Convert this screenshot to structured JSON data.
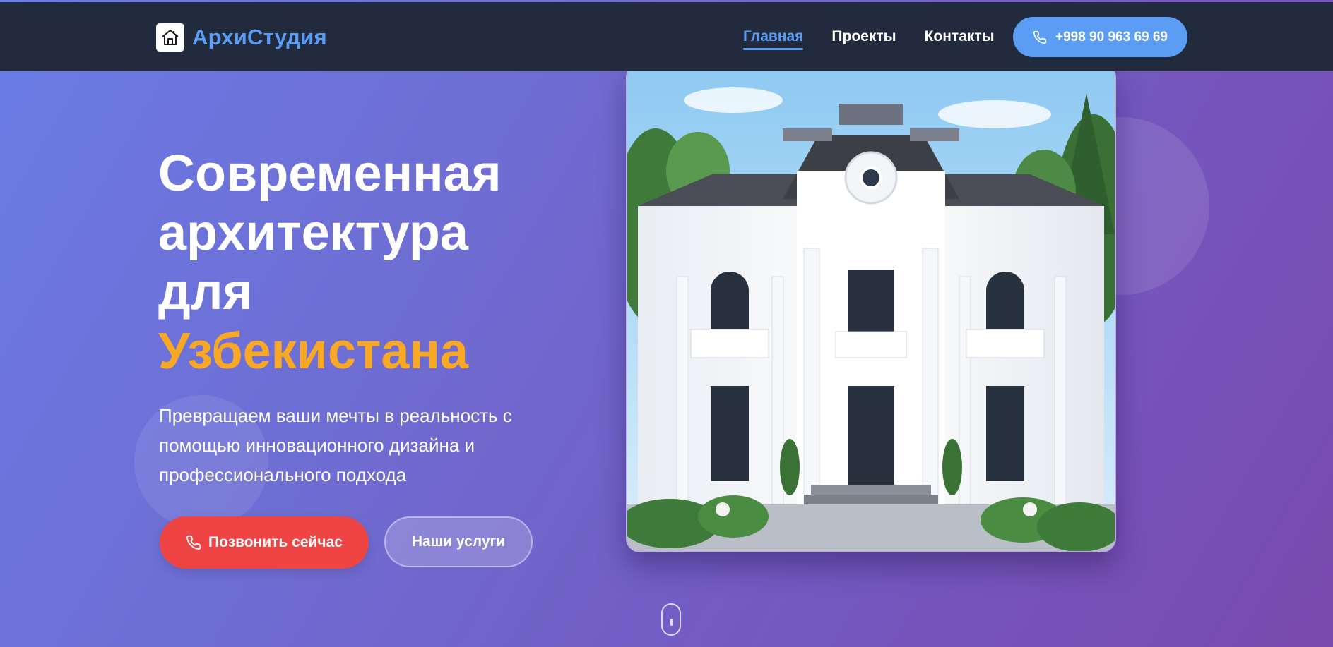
{
  "brand": {
    "name": "АрхиСтудия",
    "logo_icon": "house-logo-icon",
    "color": "#5b9df4"
  },
  "nav": {
    "items": [
      {
        "label": "Главная",
        "active": true
      },
      {
        "label": "Проекты",
        "active": false
      },
      {
        "label": "Контакты",
        "active": false
      }
    ],
    "phone_button": {
      "label": "+998 90 963 69 69",
      "icon": "phone-icon"
    }
  },
  "hero": {
    "headline": {
      "line1": "Современная",
      "line2": "архитектура",
      "line3": "для",
      "accent": "Узбекистана"
    },
    "subtitle": "Превращаем ваши мечты в реальность с помощью инновационного дизайна и профессионального подхода",
    "buttons": {
      "call": {
        "label": "Позвонить сейчас",
        "icon": "phone-icon"
      },
      "services": {
        "label": "Наши услуги"
      }
    },
    "image": {
      "subject": "white-classical-villa-photo"
    },
    "scroll_icon": "scroll-down-mouse-icon"
  },
  "colors": {
    "accent": "#5b9df4",
    "headline_accent": "#f9a825",
    "cta": "#ef4444",
    "navbar_bg": "#222b3d"
  }
}
